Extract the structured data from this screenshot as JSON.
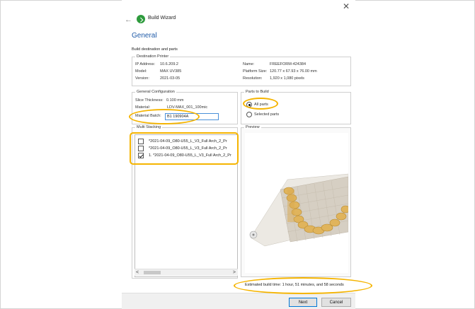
{
  "window": {
    "title": "Build Wizard",
    "close_glyph": "✕",
    "back_glyph": "←"
  },
  "page": {
    "section_title": "General",
    "subtitle": "Build destination and parts"
  },
  "destination_printer": {
    "label": "Destination Printer",
    "ip_label": "IP Address:",
    "ip_value": "10.6.209.2",
    "model_label": "Model:",
    "model_value": "MAX UV385",
    "version_label": "Version:",
    "version_value": "2021-03-05",
    "name_label": "Name:",
    "name_value": "FREEFORM-424384",
    "platform_label": "Platform Size:",
    "platform_value": "120.77 x 67.93 x 76.00 mm",
    "resolution_label": "Resolution:",
    "resolution_value": "1,920 x 1,080 pixels"
  },
  "general_config": {
    "label": "General Configuration",
    "slice_label": "Slice Thickness:",
    "slice_value": "0.100 mm",
    "material_label": "Material:",
    "material_value": "LDV-MAX_001_100mic",
    "batch_label": "Material Batch:",
    "batch_value": "B1 190904A"
  },
  "parts_to_build": {
    "label": "Parts to Build",
    "options": [
      {
        "label": "All parts",
        "selected": true
      },
      {
        "label": "Selected parts",
        "selected": false
      }
    ]
  },
  "multi_stacking": {
    "label": "Multi Stacking",
    "items": [
      {
        "checked": false,
        "text": "*2021-04-09_O80-U55_L_V3_Full Arch_2_Pr"
      },
      {
        "checked": false,
        "text": "*2021-04-09_O80-U55_L_V3_Full Arch_2_Pr"
      },
      {
        "checked": true,
        "text": "1. *2021-04-09_O80-U55_L_V3_Full Arch_2_Pr"
      }
    ],
    "scroll_left": "<",
    "scroll_right": ">"
  },
  "preview": {
    "label": "Preview"
  },
  "estimate_text": "Estimated build time: 1 hour, 51 minutes, and 58 seconds",
  "buttons": {
    "next": "Next",
    "cancel": "Cancel"
  },
  "colors": {
    "accent": "#1e5aa8",
    "highlight": "#f5b400",
    "model": "#e0b45c",
    "platform": "#d6cfc3"
  }
}
